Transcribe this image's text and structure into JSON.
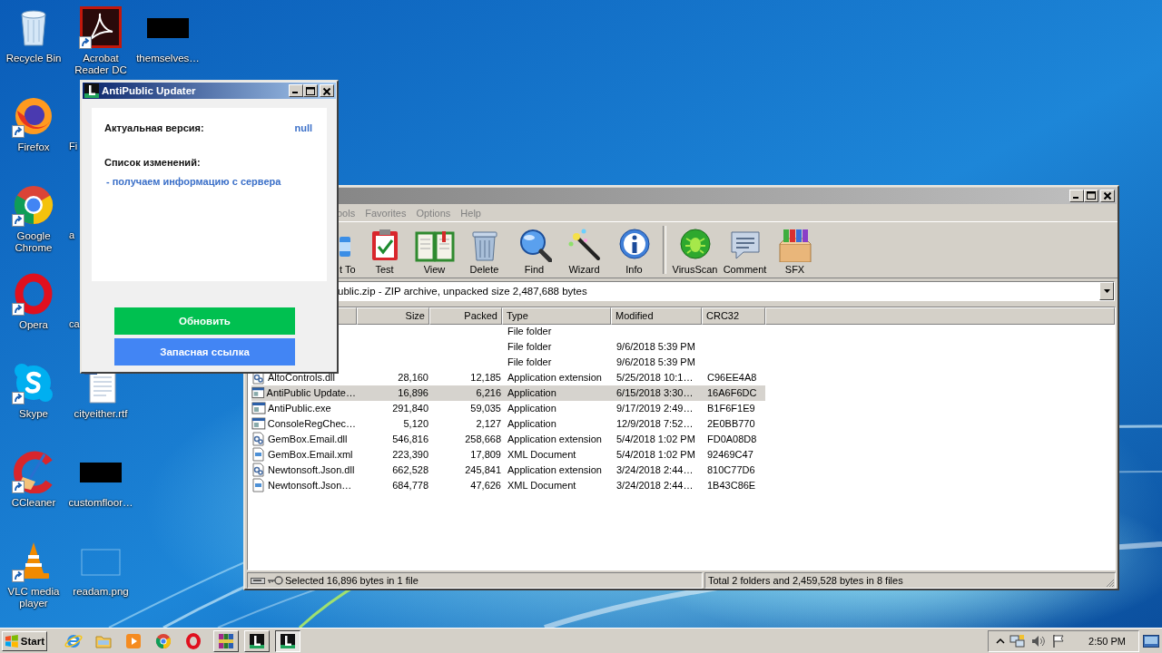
{
  "desktop": {
    "columns": [
      {
        "icons": [
          {
            "label": "Recycle Bin",
            "kind": "recycle",
            "shortcut": false
          },
          {
            "label": "Firefox",
            "kind": "firefox",
            "shortcut": true
          },
          {
            "label": "Google Chrome",
            "kind": "chrome",
            "shortcut": true
          },
          {
            "label": "Opera",
            "kind": "opera",
            "shortcut": true
          },
          {
            "label": "Skype",
            "kind": "skype",
            "shortcut": true
          },
          {
            "label": "CCleaner",
            "kind": "ccleaner",
            "shortcut": true
          },
          {
            "label": "VLC media player",
            "kind": "vlc",
            "shortcut": true
          }
        ]
      },
      {
        "icons": [
          {
            "label": "Acrobat Reader DC",
            "kind": "acrobat",
            "shortcut": true
          },
          {
            "label": "Fi",
            "kind": "hidden"
          },
          {
            "label": "a",
            "kind": "hidden"
          },
          {
            "label": "ca",
            "kind": "hidden"
          },
          {
            "label": "cityeither.rtf",
            "kind": "document",
            "shortcut": false
          },
          {
            "label": "customfloor…",
            "kind": "redacted",
            "shortcut": false
          },
          {
            "label": "readam.png",
            "kind": "blank",
            "shortcut": false
          }
        ]
      },
      {
        "icons": [
          {
            "label": "themselves…",
            "kind": "redacted",
            "shortcut": false
          }
        ]
      }
    ]
  },
  "updater": {
    "title": "AntiPublic Updater",
    "version_label": "Актуальная версия:",
    "version_value": "null",
    "changes_label": "Список изменений:",
    "changes": [
      "- получаем информацию с сервера"
    ],
    "buttons": [
      {
        "label": "Обновить",
        "color": "#00c050"
      },
      {
        "label": "Запасная ссылка",
        "color": "#4285f4"
      }
    ]
  },
  "archiver": {
    "menu": [
      "ools",
      "Favorites",
      "Options",
      "Help"
    ],
    "toolbar": [
      {
        "items": [
          {
            "label": "t To",
            "kind": "add"
          },
          {
            "label": "Test",
            "kind": "test"
          },
          {
            "label": "View",
            "kind": "view"
          },
          {
            "label": "Delete",
            "kind": "delete"
          },
          {
            "label": "Find",
            "kind": "find"
          },
          {
            "label": "Wizard",
            "kind": "wizard"
          },
          {
            "label": "Info",
            "kind": "info"
          }
        ]
      },
      {
        "items": [
          {
            "label": "VirusScan",
            "kind": "virusscan"
          },
          {
            "label": "Comment",
            "kind": "comment"
          },
          {
            "label": "SFX",
            "kind": "sfx"
          }
        ]
      }
    ],
    "address": "ublic.zip - ZIP archive, unpacked size 2,487,688 bytes",
    "columns": [
      "Size",
      "Packed",
      "Type",
      "Modified",
      "CRC32"
    ],
    "rows": [
      {
        "type": "File folder",
        "selected": false
      },
      {
        "type": "File folder",
        "modified": "9/6/2018 5:39 PM",
        "selected": false
      },
      {
        "type": "File folder",
        "modified": "9/6/2018 5:39 PM",
        "selected": false
      },
      {
        "kind": "dll",
        "name": "AltoControls.dll",
        "size": "28,160",
        "packed": "12,185",
        "type": "Application extension",
        "modified": "5/25/2018 10:1…",
        "crc": "C96EE4A8",
        "selected": false
      },
      {
        "kind": "exe",
        "name": "AntiPublic Update…",
        "size": "16,896",
        "packed": "6,216",
        "type": "Application",
        "modified": "6/15/2018 3:30…",
        "crc": "16A6F6DC",
        "selected": true
      },
      {
        "kind": "exe",
        "name": "AntiPublic.exe",
        "size": "291,840",
        "packed": "59,035",
        "type": "Application",
        "modified": "9/17/2019 2:49…",
        "crc": "B1F6F1E9",
        "selected": false
      },
      {
        "kind": "exe",
        "name": "ConsoleRegChec…",
        "size": "5,120",
        "packed": "2,127",
        "type": "Application",
        "modified": "12/9/2018 7:52…",
        "crc": "2E0BB770",
        "selected": false
      },
      {
        "kind": "dll",
        "name": "GemBox.Email.dll",
        "size": "546,816",
        "packed": "258,668",
        "type": "Application extension",
        "modified": "5/4/2018 1:02 PM",
        "crc": "FD0A08D8",
        "selected": false
      },
      {
        "kind": "xml",
        "name": "GemBox.Email.xml",
        "size": "223,390",
        "packed": "17,809",
        "type": "XML Document",
        "modified": "5/4/2018 1:02 PM",
        "crc": "92469C47",
        "selected": false
      },
      {
        "kind": "dll",
        "name": "Newtonsoft.Json.dll",
        "size": "662,528",
        "packed": "245,841",
        "type": "Application extension",
        "modified": "3/24/2018 2:44…",
        "crc": "810C77D6",
        "selected": false
      },
      {
        "kind": "xml",
        "name": "Newtonsoft.Json…",
        "size": "684,778",
        "packed": "47,626",
        "type": "XML Document",
        "modified": "3/24/2018 2:44…",
        "crc": "1B43C86E",
        "selected": false
      }
    ],
    "status": {
      "left": "Selected 16,896 bytes in 1 file",
      "right": "Total 2 folders and 2,459,528 bytes in 8 files"
    }
  },
  "taskbar": {
    "start_label": "Start",
    "items": [
      {
        "kind": "ie",
        "open": false,
        "selected": false
      },
      {
        "kind": "explorer",
        "open": false,
        "selected": false
      },
      {
        "kind": "media",
        "open": false,
        "selected": false
      },
      {
        "kind": "chrome",
        "open": false,
        "selected": false
      },
      {
        "kind": "opera",
        "open": false,
        "selected": false
      },
      {
        "kind": "winrar",
        "open": true,
        "selected": false
      },
      {
        "kind": "lapp",
        "open": true,
        "selected": false
      },
      {
        "kind": "lapp",
        "open": true,
        "selected": true
      }
    ],
    "clock": "2:50 PM"
  }
}
